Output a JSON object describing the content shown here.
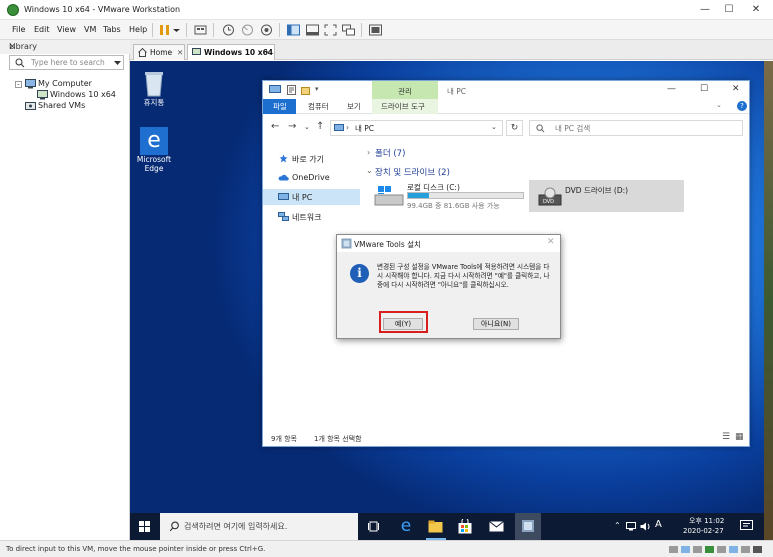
{
  "window": {
    "title": "Windows 10 x64 - VMware Workstation"
  },
  "menu": {
    "items": [
      "File",
      "Edit",
      "View",
      "VM",
      "Tabs",
      "Help"
    ],
    "toolbar_icons": [
      "pause-icon",
      "dropdown-icon",
      "send-keys-icon",
      "snapshot-icon",
      "revert-snapshot-icon",
      "manage-snapshots-icon",
      "library-view-icon",
      "thumbnail-view-icon",
      "full-screen-icon",
      "unity-icon",
      "console-view-icon"
    ]
  },
  "library": {
    "title": "Library",
    "search_placeholder": "Type here to search",
    "tree": [
      {
        "label": "My Computer"
      },
      {
        "label": "Windows 10 x64"
      },
      {
        "label": "Shared VMs"
      }
    ]
  },
  "tabs": [
    {
      "label": "Home"
    },
    {
      "label": "Windows 10 x64"
    }
  ],
  "desktop": {
    "icons": [
      {
        "label": "휴지통",
        "icon": "recycle-bin-icon"
      },
      {
        "label": "Microsoft Edge",
        "icon": "edge-icon"
      }
    ]
  },
  "explorer": {
    "title": "내 PC",
    "manage_tab": "관리",
    "ribbon_tabs": [
      "파일",
      "컴퓨터",
      "보기",
      "드라이브 도구"
    ],
    "address": "내 PC",
    "search_placeholder": "내 PC 검색",
    "nav": [
      {
        "label": "바로 가기"
      },
      {
        "label": "OneDrive"
      },
      {
        "label": "내 PC"
      },
      {
        "label": "네트워크"
      }
    ],
    "sections": [
      {
        "label": "폴더 (7)"
      },
      {
        "label": "장치 및 드라이브 (2)"
      }
    ],
    "drives": [
      {
        "name": "로컬 디스크 (C:)",
        "space": "99.4GB 중 81.6GB 사용 가능",
        "used_fraction": 0.18
      },
      {
        "name": "DVD 드라이브 (D:)"
      }
    ],
    "status": {
      "count": "9개 항목",
      "selected": "1개 항목 선택함"
    }
  },
  "dialog": {
    "title": "VMware Tools 설치",
    "message": "변경된 구성 설정을 VMware Tools에 적용하려면 시스템을 다시 시작해야 합니다. 지금 다시 시작하려면 \"예\"를 클릭하고, 나중에 다시 시작하려면 \"아니요\"를 클릭하십시오.",
    "yes_label": "예(Y)",
    "no_label": "아니요(N)"
  },
  "taskbar": {
    "search_placeholder": "검색하려면 여기에 입력하세요.",
    "ime": "A",
    "time": "오후 11:02",
    "date": "2020-02-27"
  },
  "status_bar": {
    "text": "To direct input to this VM, move the mouse pointer inside or press Ctrl+G."
  },
  "colors": {
    "accent": "#0078d7",
    "manage_tab": "#c6e8b0",
    "highlight": "#d81e1e",
    "taskbar": "#0c1b33"
  }
}
